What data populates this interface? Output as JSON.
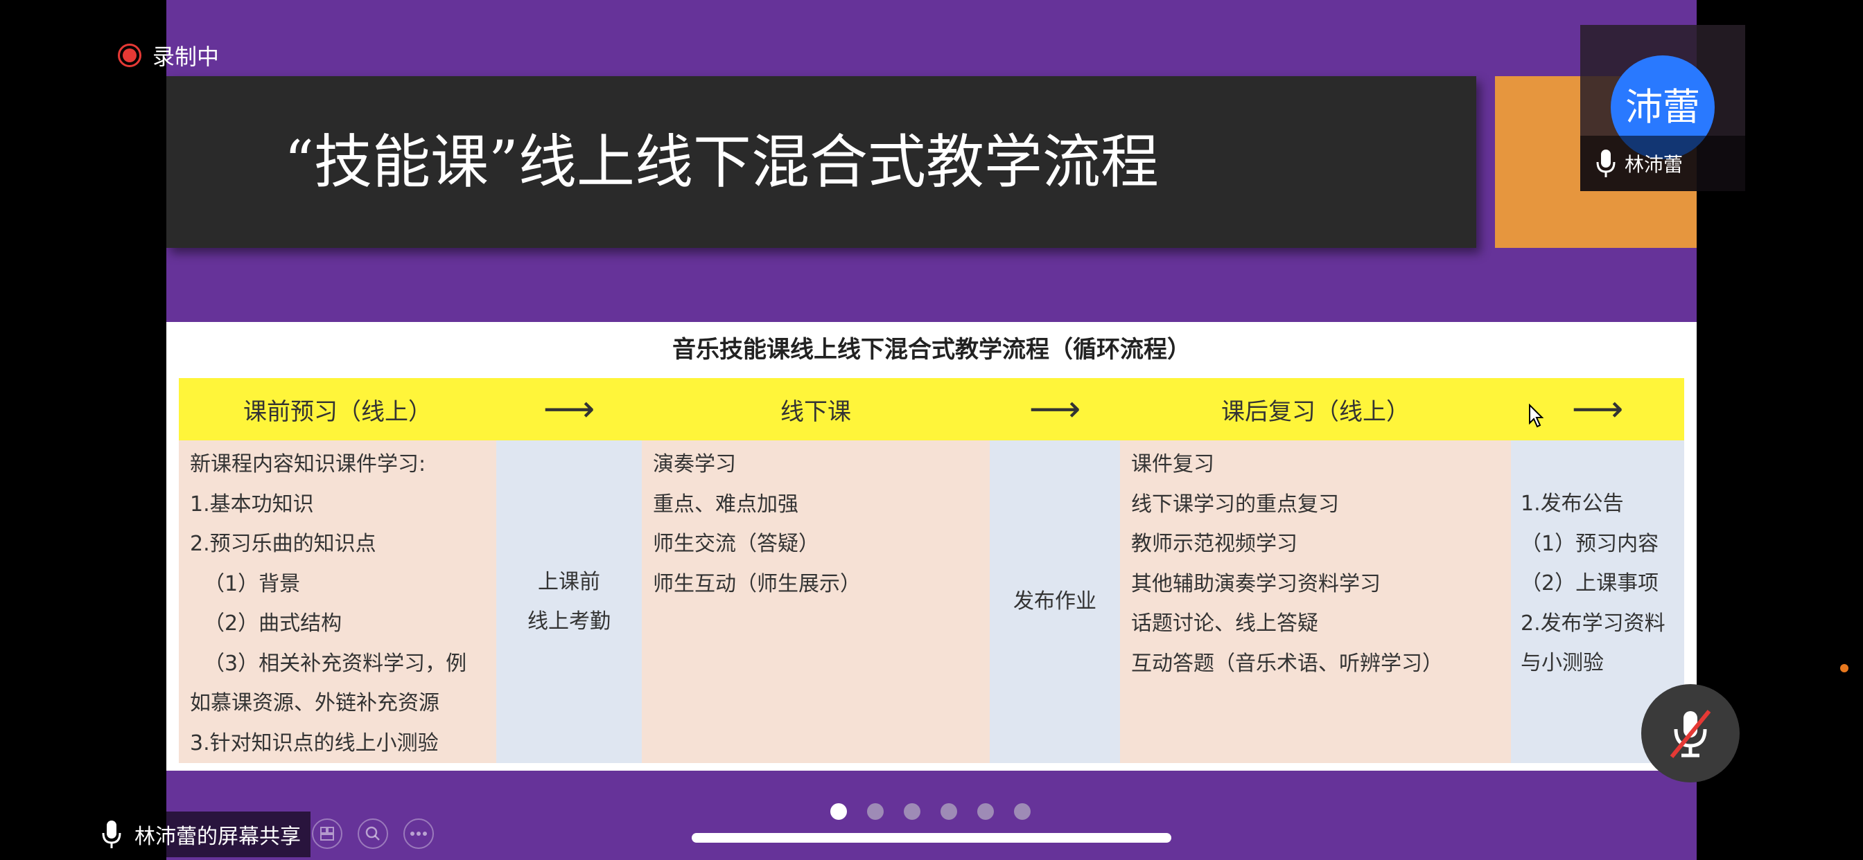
{
  "recording": {
    "label": "录制中"
  },
  "slide": {
    "title": "“技能课”线上线下混合式教学流程",
    "subtitle": "音乐技能课线上线下混合式教学流程（循环流程）",
    "headers": [
      "课前预习（线上）",
      "⟶",
      "线下课",
      "⟶",
      "课后复习（线上）",
      "⟶"
    ],
    "col1": [
      "新课程内容知识课件学习:",
      "1.基本功知识",
      "2.预习乐曲的知识点",
      "（1）背景",
      "（2）曲式结构",
      "（3）相关补充资料学习，例",
      "如慕课资源、外链补充资源",
      "3.针对知识点的线上小测验"
    ],
    "col2": [
      "上课前",
      "线上考勤"
    ],
    "col3": [
      "演奏学习",
      "重点、难点加强",
      "师生交流（答疑）",
      "师生互动（师生展示）"
    ],
    "col4": [
      "发布作业"
    ],
    "col5": [
      "课件复习",
      "线下课学习的重点复习",
      "教师示范视频学习",
      "其他辅助演奏学习资料学习",
      "话题讨论、线上答疑",
      "互动答题（音乐术语、听辨学习）"
    ],
    "col6": [
      "1.发布公告",
      "（1）预习内容",
      "（2）上课事项",
      "2.发布学习资料",
      "与小测验"
    ]
  },
  "participant": {
    "avatar_text": "沛蕾",
    "name": "林沛蕾"
  },
  "share": {
    "label": "林沛蕾的屏幕共享"
  },
  "pager": {
    "total": 6,
    "active": 1
  },
  "colors": {
    "slide_bg": "#663399",
    "header_yellow": "#fff53a",
    "peach": "#f6e1d5",
    "blue": "#dfe6f1",
    "accent_orange": "#e6963e",
    "avatar_blue": "#2979ff",
    "record_red": "#e53935"
  }
}
